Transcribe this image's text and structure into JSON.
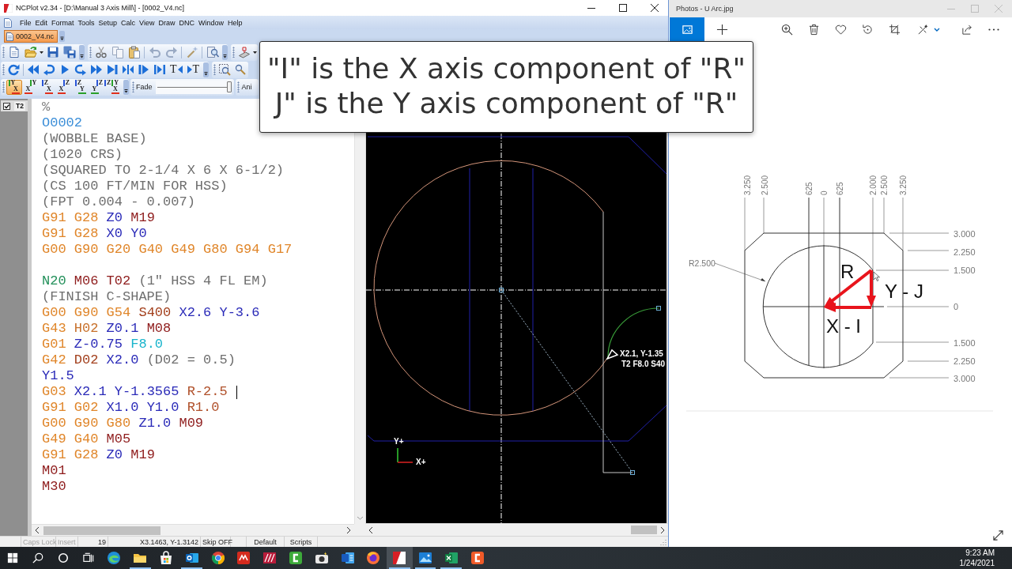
{
  "ncplot": {
    "title": "NCPlot v2.34 - [D:\\Manual 3 Axis Mill\\] - [0002_V4.nc]",
    "menu": [
      "File",
      "Edit",
      "Format",
      "Tools",
      "Setup",
      "Calc",
      "View",
      "Draw",
      "DNC",
      "Window",
      "Help"
    ],
    "document_tabs": [
      {
        "label": "0002_V4.nc",
        "selected": true
      }
    ],
    "trace_buttons": [
      {
        "kind": "back",
        "label": "T"
      },
      {
        "kind": "forward",
        "label": "T"
      }
    ],
    "view_buttons": [
      {
        "selected": true,
        "axes": [
          {
            "letter": "Y",
            "color": "#2aa02a"
          },
          {
            "letter": "X",
            "color": "#e0301e"
          }
        ]
      },
      {
        "selected": false,
        "axes": [
          {
            "letter": "Y",
            "color": "#2aa02a"
          },
          {
            "letter": "X",
            "color": "#e0301e"
          }
        ]
      },
      {
        "selected": false,
        "axes": [
          {
            "letter": "Z",
            "color": "#2a55d6"
          },
          {
            "letter": "X",
            "color": "#e0301e"
          }
        ]
      },
      {
        "selected": false,
        "axes": [
          {
            "letter": "Z",
            "color": "#2a55d6"
          },
          {
            "letter": "X",
            "color": "#e0301e"
          }
        ]
      },
      {
        "selected": false,
        "axes": [
          {
            "letter": "Z",
            "color": "#2a55d6"
          },
          {
            "letter": "Y",
            "color": "#2aa02a"
          }
        ]
      },
      {
        "selected": false,
        "axes": [
          {
            "letter": "Z",
            "color": "#2a55d6"
          },
          {
            "letter": "Y",
            "color": "#2aa02a"
          }
        ]
      },
      {
        "selected": false,
        "axes": [
          {
            "letter": "Z",
            "color": "#2a55d6"
          },
          {
            "letter": "Y",
            "color": "#2aa02a"
          },
          {
            "letter": "X",
            "color": "#e0301e"
          }
        ]
      }
    ],
    "fade": {
      "label": "Fade",
      "level": 1
    },
    "animation_label": "Ani",
    "gutter_tab": "T2",
    "program": [
      {
        "lines": [
          {
            "caret": false,
            "tokens": [
              {
                "kind": "percent",
                "text": "%"
              }
            ]
          },
          {
            "caret": false,
            "tokens": [
              {
                "kind": "program",
                "text": "O0002"
              }
            ]
          },
          {
            "caret": false,
            "tokens": [
              {
                "kind": "comment",
                "text": "(WOBBLE BASE)"
              }
            ]
          },
          {
            "caret": false,
            "tokens": [
              {
                "kind": "comment",
                "text": "(1020 CRS)"
              }
            ]
          },
          {
            "caret": false,
            "tokens": [
              {
                "kind": "comment",
                "text": "(SQUARED TO 2-1/4 X 6 X 6-1/2)"
              }
            ]
          },
          {
            "caret": false,
            "tokens": [
              {
                "kind": "comment",
                "text": "(CS 100 FT/MIN FOR HSS)"
              }
            ]
          },
          {
            "caret": false,
            "tokens": [
              {
                "kind": "comment",
                "text": "(FPT 0.004 - 0.007)"
              }
            ]
          },
          {
            "caret": false,
            "tokens": [
              {
                "kind": "g",
                "text": "G91"
              },
              {
                "kind": "g",
                "text": "G28"
              },
              {
                "kind": "axis",
                "text": "Z0"
              },
              {
                "kind": "m",
                "text": "M19"
              }
            ]
          },
          {
            "caret": false,
            "tokens": [
              {
                "kind": "g",
                "text": "G91"
              },
              {
                "kind": "g",
                "text": "G28"
              },
              {
                "kind": "axis",
                "text": "X0"
              },
              {
                "kind": "axis",
                "text": "Y0"
              }
            ]
          },
          {
            "caret": false,
            "tokens": [
              {
                "kind": "g",
                "text": "G00"
              },
              {
                "kind": "g",
                "text": "G90"
              },
              {
                "kind": "g",
                "text": "G20"
              },
              {
                "kind": "g",
                "text": "G40"
              },
              {
                "kind": "g",
                "text": "G49"
              },
              {
                "kind": "g",
                "text": "G80"
              },
              {
                "kind": "g",
                "text": "G94"
              },
              {
                "kind": "g",
                "text": "G17"
              }
            ]
          }
        ]
      },
      {
        "lines": [
          {
            "caret": false,
            "tokens": [
              {
                "kind": "seq",
                "text": "N20"
              },
              {
                "kind": "m",
                "text": "M06"
              },
              {
                "kind": "t",
                "text": "T02"
              },
              {
                "kind": "comment",
                "text": "(1\" HSS 4 FL EM)"
              }
            ]
          },
          {
            "caret": false,
            "tokens": [
              {
                "kind": "comment",
                "text": "(FINISH C-SHAPE)"
              }
            ]
          },
          {
            "caret": false,
            "tokens": [
              {
                "kind": "g",
                "text": "G00"
              },
              {
                "kind": "g",
                "text": "G90"
              },
              {
                "kind": "g",
                "text": "G54"
              },
              {
                "kind": "s",
                "text": "S400"
              },
              {
                "kind": "axis",
                "text": "X2.6"
              },
              {
                "kind": "axis",
                "text": "Y-3.6"
              }
            ]
          },
          {
            "caret": false,
            "tokens": [
              {
                "kind": "g",
                "text": "G43"
              },
              {
                "kind": "h",
                "text": "H02"
              },
              {
                "kind": "axis",
                "text": "Z0.1"
              },
              {
                "kind": "m",
                "text": "M08"
              }
            ]
          },
          {
            "caret": false,
            "tokens": [
              {
                "kind": "g",
                "text": "G01"
              },
              {
                "kind": "axis",
                "text": "Z-0.75"
              },
              {
                "kind": "f",
                "text": "F8.0"
              }
            ]
          },
          {
            "caret": false,
            "tokens": [
              {
                "kind": "g",
                "text": "G42"
              },
              {
                "kind": "d",
                "text": "D02"
              },
              {
                "kind": "axis",
                "text": "X2.0"
              },
              {
                "kind": "comment",
                "text": "(D02 = 0.5)"
              }
            ]
          },
          {
            "caret": false,
            "tokens": [
              {
                "kind": "axis",
                "text": "Y1.5"
              }
            ]
          },
          {
            "caret": true,
            "tokens": [
              {
                "kind": "g",
                "text": "G03"
              },
              {
                "kind": "axis",
                "text": "X2.1"
              },
              {
                "kind": "axis",
                "text": "Y-1.3565"
              },
              {
                "kind": "r",
                "text": "R-2.5"
              }
            ]
          },
          {
            "caret": false,
            "tokens": [
              {
                "kind": "g",
                "text": "G91"
              },
              {
                "kind": "g",
                "text": "G02"
              },
              {
                "kind": "axis",
                "text": "X1.0"
              },
              {
                "kind": "axis",
                "text": "Y1.0"
              },
              {
                "kind": "r",
                "text": "R1.0"
              }
            ]
          },
          {
            "caret": false,
            "tokens": [
              {
                "kind": "g",
                "text": "G00"
              },
              {
                "kind": "g",
                "text": "G90"
              },
              {
                "kind": "g",
                "text": "G80"
              },
              {
                "kind": "axis",
                "text": "Z1.0"
              },
              {
                "kind": "m",
                "text": "M09"
              }
            ]
          },
          {
            "caret": false,
            "tokens": [
              {
                "kind": "g",
                "text": "G49"
              },
              {
                "kind": "g",
                "text": "G40"
              },
              {
                "kind": "m",
                "text": "M05"
              }
            ]
          },
          {
            "caret": false,
            "tokens": [
              {
                "kind": "g",
                "text": "G91"
              },
              {
                "kind": "g",
                "text": "G28"
              },
              {
                "kind": "axis",
                "text": "Z0"
              },
              {
                "kind": "m",
                "text": "M19"
              }
            ]
          },
          {
            "caret": false,
            "tokens": [
              {
                "kind": "m",
                "text": "M01"
              }
            ]
          },
          {
            "caret": false,
            "tokens": [
              {
                "kind": "m",
                "text": "M30"
              }
            ]
          }
        ]
      }
    ],
    "plot": {
      "position_label": "X2.1, Y-1.35",
      "tool_label": "T2 F8.0 S40",
      "y_axis_label": "Y+",
      "x_axis_label": "X+"
    },
    "status_bar": {
      "caps_lock": {
        "label": "Caps Lock",
        "on": false
      },
      "insert": {
        "label": "Insert",
        "on": false
      },
      "line": "19",
      "position": "X3.1463, Y-1.3142",
      "skip": "Skip OFF",
      "mode": "Default",
      "scripts": "Scripts"
    }
  },
  "callout": {
    "lines": [
      "\"I\" is the X axis component of \"R\"",
      "J\" is the Y axis component of \"R\""
    ]
  },
  "photos": {
    "title": "Photos - U Arc.jpg",
    "drawing": {
      "top_dimensions": [
        "3.250",
        "2.500",
        "625",
        "0",
        "625",
        "2.000",
        "2.500",
        "3.250"
      ],
      "right_dimensions": [
        "3.000",
        "2.250",
        "1.500",
        "0",
        "1.500",
        "2.250",
        "3.000"
      ],
      "radius_label": "R2.500",
      "vector_labels": [
        "R",
        "Y - J",
        "X - I"
      ]
    }
  },
  "taskbar": {
    "apps": [
      {
        "running": false,
        "active": false
      },
      {
        "running": true,
        "active": false
      },
      {
        "running": false,
        "active": false
      },
      {
        "running": true,
        "active": false
      },
      {
        "running": false,
        "active": false
      },
      {
        "running": false,
        "active": false
      },
      {
        "running": false,
        "active": false
      },
      {
        "running": false,
        "active": false
      },
      {
        "running": false,
        "active": false
      },
      {
        "running": false,
        "active": false
      },
      {
        "running": false,
        "active": false
      },
      {
        "running": true,
        "active": true
      },
      {
        "running": true,
        "active": false
      },
      {
        "running": true,
        "active": false
      },
      {
        "running": false,
        "active": false
      }
    ],
    "time": "9:23 AM",
    "date": "1/24/2021"
  }
}
